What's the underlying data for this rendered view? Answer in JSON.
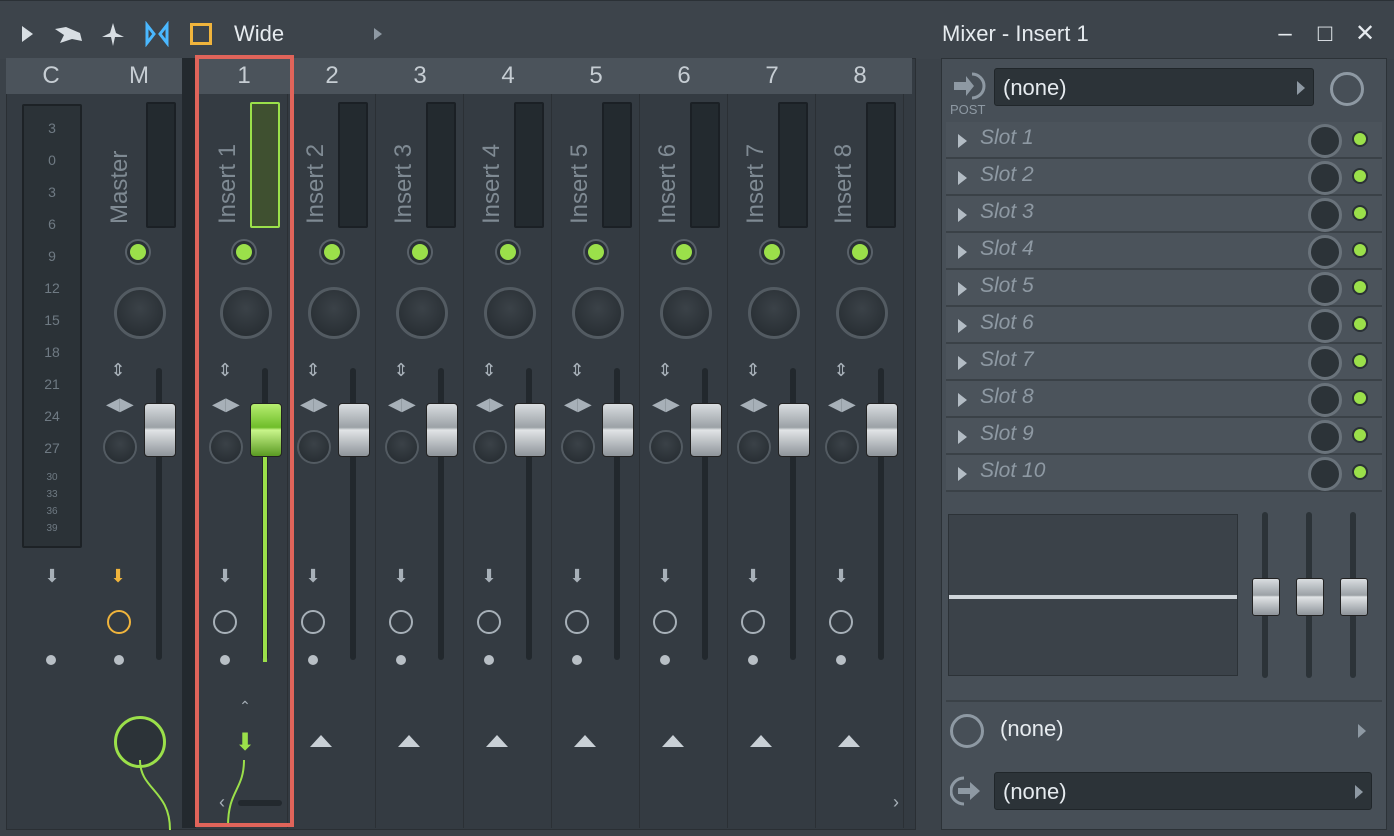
{
  "toolbar": {
    "preset_label": "Wide",
    "window_title": "Mixer - Insert 1"
  },
  "strips": [
    {
      "header": "C",
      "name": ""
    },
    {
      "header": "M",
      "name": "Master"
    },
    {
      "header": "1",
      "name": "Insert 1"
    },
    {
      "header": "2",
      "name": "Insert 2"
    },
    {
      "header": "3",
      "name": "Insert 3"
    },
    {
      "header": "4",
      "name": "Insert 4"
    },
    {
      "header": "5",
      "name": "Insert 5"
    },
    {
      "header": "6",
      "name": "Insert 6"
    },
    {
      "header": "7",
      "name": "Insert 7"
    },
    {
      "header": "8",
      "name": "Insert 8"
    }
  ],
  "db_scale": [
    "3",
    "0",
    "3",
    "6",
    "9",
    "12",
    "15",
    "18",
    "21",
    "24",
    "27",
    "30",
    "33",
    "36",
    "39"
  ],
  "panel": {
    "post_label": "POST",
    "input_value": "(none)",
    "slots": [
      "Slot 1",
      "Slot 2",
      "Slot 3",
      "Slot 4",
      "Slot 5",
      "Slot 6",
      "Slot 7",
      "Slot 8",
      "Slot 9",
      "Slot 10"
    ],
    "time_value": "(none)",
    "output_value": "(none)"
  },
  "colors": {
    "accent_green": "#9be04a",
    "selection_red": "#e0645a",
    "master_orange": "#f0b43c"
  }
}
